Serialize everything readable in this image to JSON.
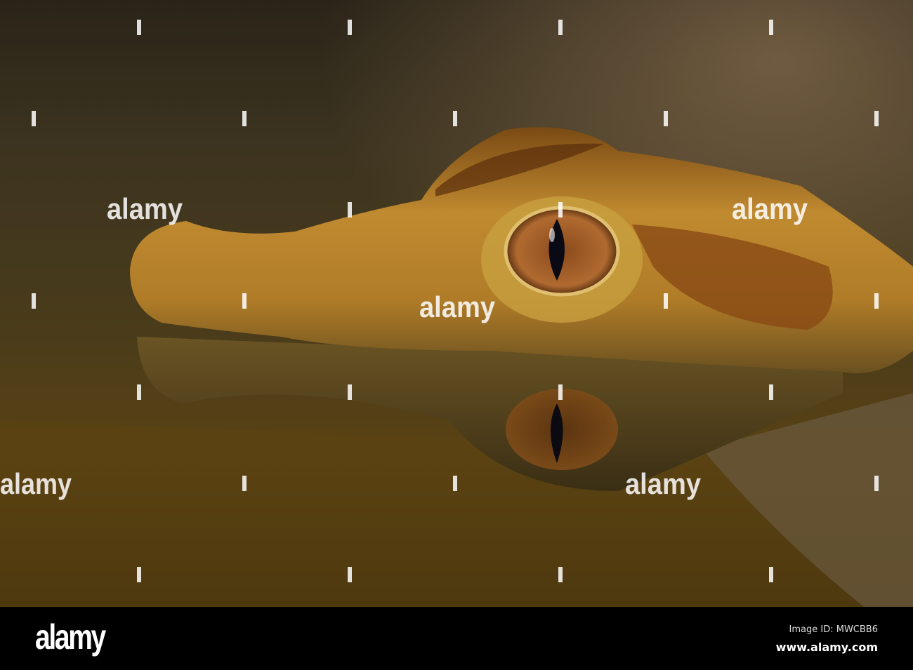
{
  "photo": {
    "subject": "caiman",
    "watermark_text": "alamy",
    "colors": {
      "water": "#4a3a18",
      "skin": "#c08a30",
      "eye": "#a0602a",
      "pupil": "#0a0a14"
    }
  },
  "footer": {
    "logo": "alamy",
    "image_id": "Image ID: MWCBB6",
    "url": "www.alamy.com"
  }
}
